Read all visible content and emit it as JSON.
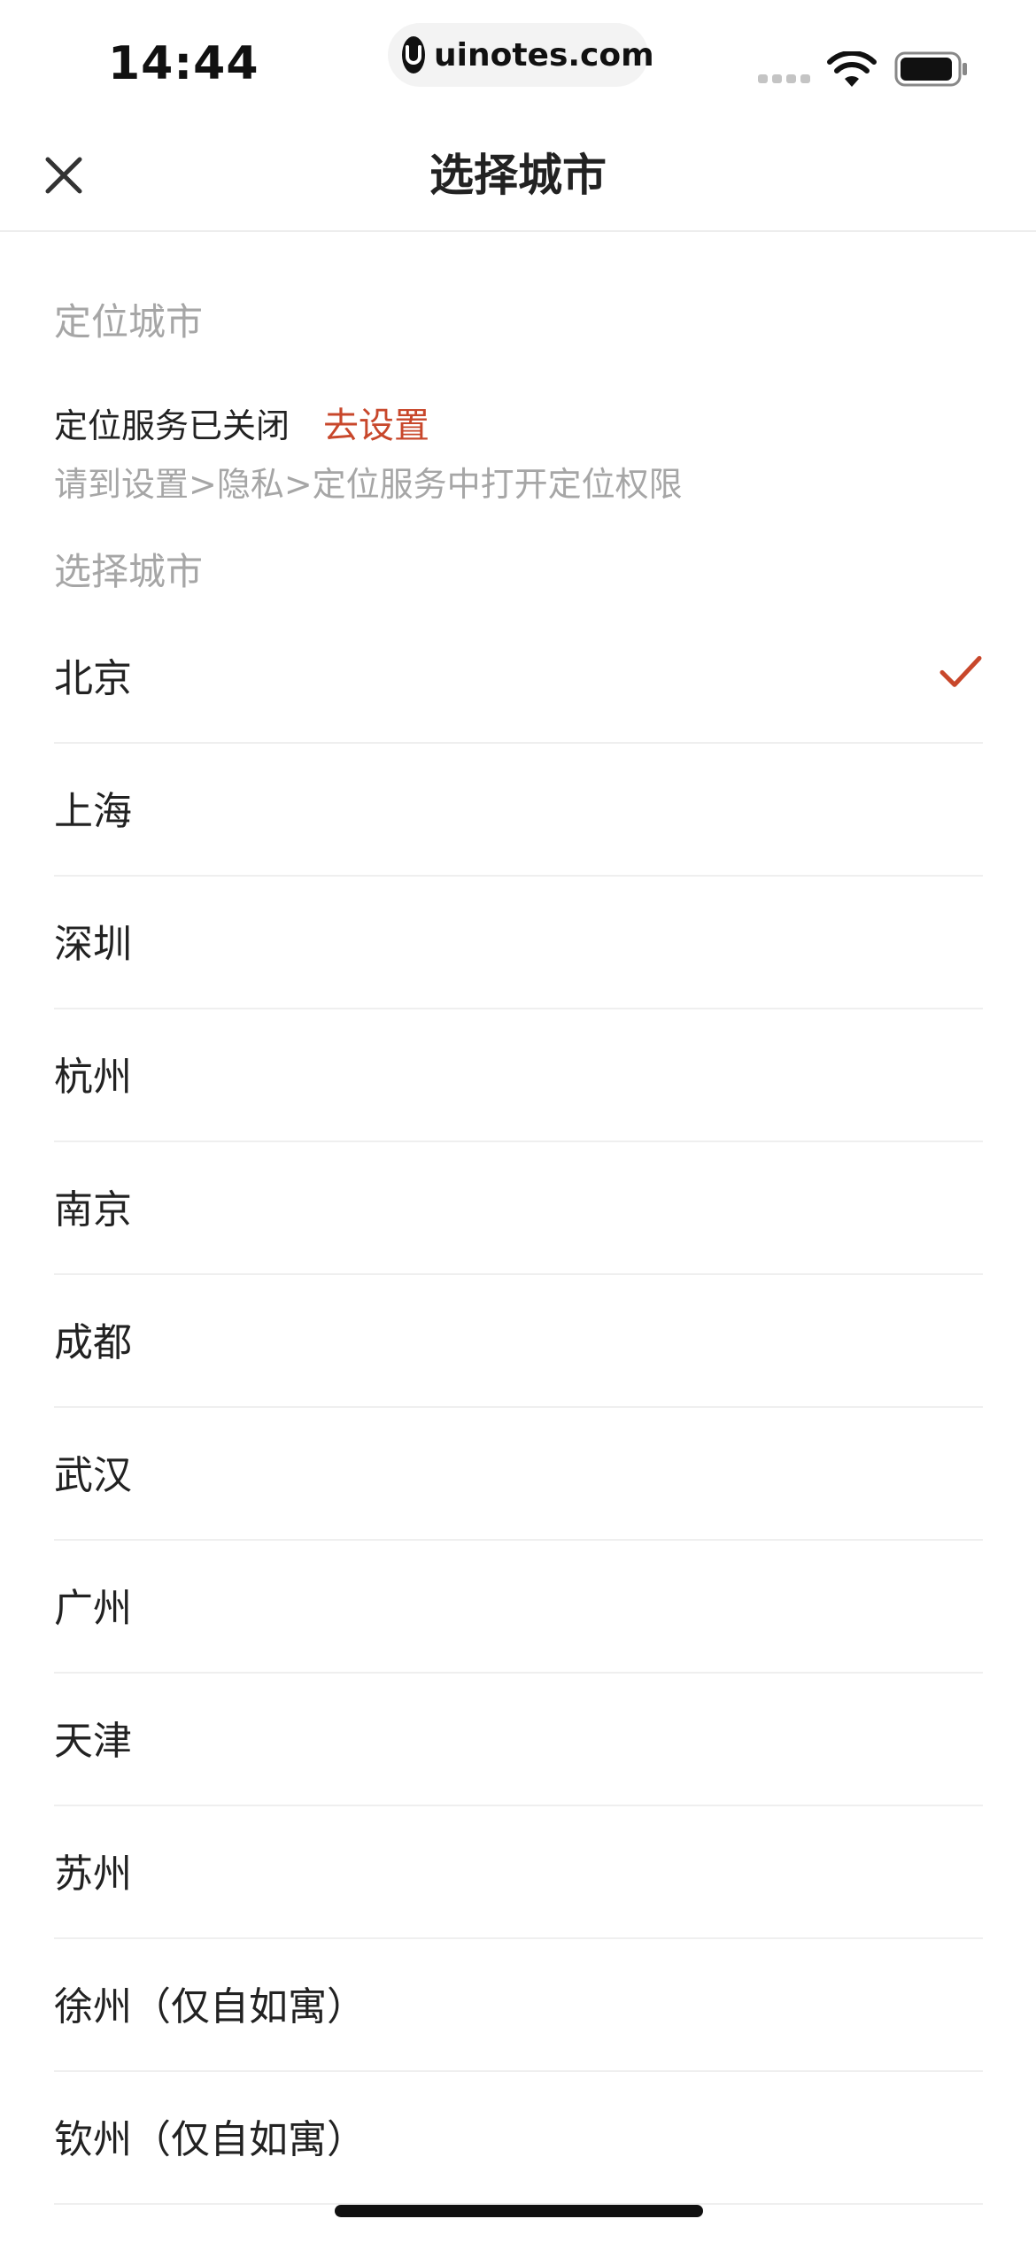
{
  "status_bar": {
    "time": "14:44",
    "url": "uinotes.com",
    "icons": [
      "signal-icon",
      "wifi-icon",
      "battery-icon"
    ]
  },
  "nav": {
    "title": "选择城市",
    "close_icon": "close-icon"
  },
  "location": {
    "section_label": "定位城市",
    "status_text": "定位服务已关闭",
    "action_label": "去设置",
    "hint": "请到设置>隐私>定位服务中打开定位权限"
  },
  "city_section_label": "选择城市",
  "cities": [
    {
      "name": "北京",
      "selected": true
    },
    {
      "name": "上海",
      "selected": false
    },
    {
      "name": "深圳",
      "selected": false
    },
    {
      "name": "杭州",
      "selected": false
    },
    {
      "name": "南京",
      "selected": false
    },
    {
      "name": "成都",
      "selected": false
    },
    {
      "name": "武汉",
      "selected": false
    },
    {
      "name": "广州",
      "selected": false
    },
    {
      "name": "天津",
      "selected": false
    },
    {
      "name": "苏州",
      "selected": false
    },
    {
      "name": "徐州（仅自如寓）",
      "selected": false
    },
    {
      "name": "钦州（仅自如寓）",
      "selected": false
    }
  ],
  "colors": {
    "accent": "#c8472b",
    "secondary_text": "#a6a6a6",
    "primary_text": "#222222",
    "divider": "#efefef"
  }
}
